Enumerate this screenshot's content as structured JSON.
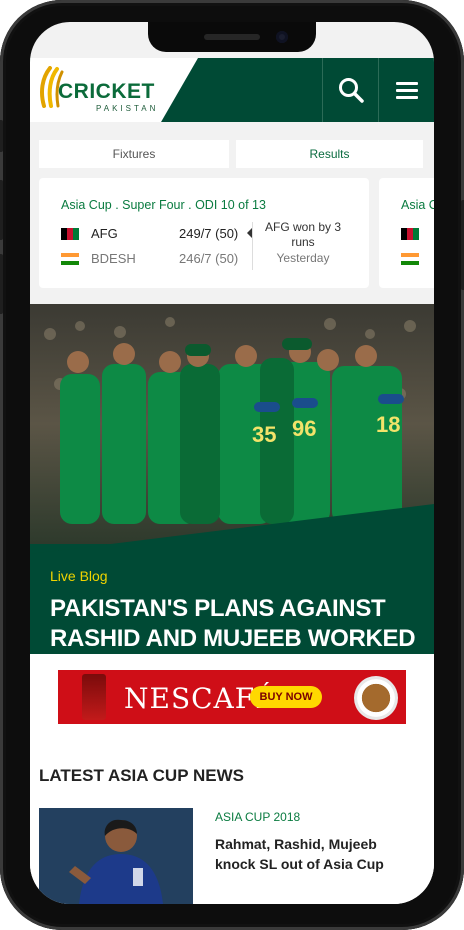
{
  "header": {
    "brand_name": "CRICKET",
    "brand_sub": "PAKISTAN",
    "search_icon": "search-icon",
    "menu_icon": "hamburger-menu-icon",
    "colors": {
      "primary": "#004a35",
      "accent": "#0a7b40",
      "highlight": "#f0d400"
    }
  },
  "tabs": {
    "fixtures_label": "Fixtures",
    "results_label": "Results"
  },
  "match": {
    "title": "Asia Cup . Super Four . ODI 10 of 13",
    "team1": {
      "name": "AFG",
      "score": "249/7 (50)"
    },
    "team2": {
      "name": "BDESH",
      "score": "246/7 (50)"
    },
    "result": "AFG  won by 3 runs",
    "day": "Yesterday"
  },
  "next_match": {
    "title_fragment": "Asia C"
  },
  "hero": {
    "tag": "Live Blog",
    "title": "PAKISTAN'S PLANS AGAINST RASHID AND MUJEEB WORKED"
  },
  "ad": {
    "brand": "NESCAFÉ",
    "cta": "BUY NOW"
  },
  "news": {
    "heading": "LATEST ASIA CUP NEWS",
    "items": [
      {
        "tag": "ASIA CUP 2018",
        "title": "Rahmat, Rashid, Mujeeb knock SL out of Asia Cup"
      }
    ]
  }
}
